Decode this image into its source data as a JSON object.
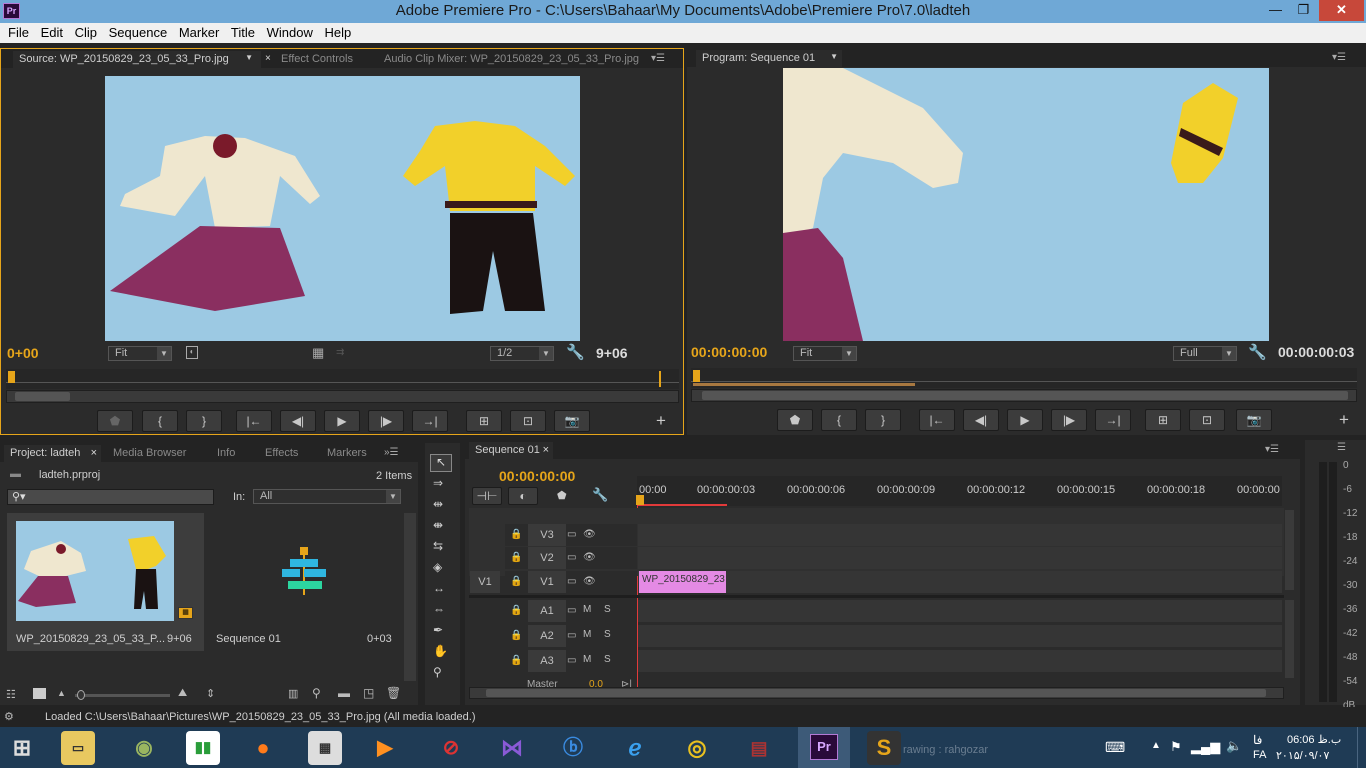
{
  "window": {
    "title": "Adobe Premiere Pro - C:\\Users\\Bahaar\\My Documents\\Adobe\\Premiere Pro\\7.0\\ladteh",
    "app_icon": "Pr",
    "min": "—",
    "max": "❐",
    "close": "✕"
  },
  "menu": [
    "File",
    "Edit",
    "Clip",
    "Sequence",
    "Marker",
    "Title",
    "Window",
    "Help"
  ],
  "source": {
    "tabs": [
      "Source: WP_20150829_23_05_33_Pro.jpg",
      "Effect Controls",
      "Audio Clip Mixer: WP_20150829_23_05_33_Pro.jpg"
    ],
    "timecode": "0+00",
    "zoom": "Fit",
    "resolution": "1/2",
    "duration": "9+06",
    "playhead": 0.97
  },
  "program": {
    "tab": "Program: Sequence 01",
    "timecode": "00:00:00:00",
    "zoom": "Fit",
    "resolution": "Full",
    "duration": "00:00:00:03"
  },
  "project": {
    "tabs": [
      "Project: ladteh",
      "Media Browser",
      "Info",
      "Effects",
      "Markers"
    ],
    "file": "ladteh.prproj",
    "count": "2 Items",
    "in_label": "In:",
    "in_value": "All",
    "items": [
      {
        "name": "WP_20150829_23_05_33_P...",
        "duration": "9+06"
      },
      {
        "name": "Sequence 01",
        "duration": "0+03"
      }
    ]
  },
  "timeline": {
    "tab": "Sequence 01",
    "timecode": "00:00:00:00",
    "ruler": [
      "00:00",
      "00:00:00:03",
      "00:00:00:06",
      "00:00:00:09",
      "00:00:00:12",
      "00:00:00:15",
      "00:00:00:18",
      "00:00:00"
    ],
    "video_tracks": [
      "V3",
      "V2",
      "V1"
    ],
    "audio_tracks": [
      "A1",
      "A2",
      "A3"
    ],
    "source_patch": "V1",
    "master": "Master",
    "master_val": "0.0",
    "clip": "WP_20150829_23",
    "m": "M",
    "s": "S"
  },
  "meter": {
    "labels": [
      "0",
      "-6",
      "-12",
      "-18",
      "-24",
      "-30",
      "-36",
      "-42",
      "-48",
      "-54",
      "dB"
    ]
  },
  "status": "Loaded C:\\Users\\Bahaar\\Pictures\\WP_20150829_23_05_33_Pro.jpg (All media loaded.)",
  "taskbar": {
    "ghost_text": "rawing : rahgozar",
    "lang": "FA",
    "time": "06:06 ب.ظ",
    "date": "۲۰۱۵/۰۹/۰۷",
    "fa_glyph": "فا"
  },
  "colors": {
    "accent": "#e6a51a",
    "clip": "#e48ae4",
    "playhead": "#e23a3a",
    "cloth_bg": "#9cc9e3"
  }
}
